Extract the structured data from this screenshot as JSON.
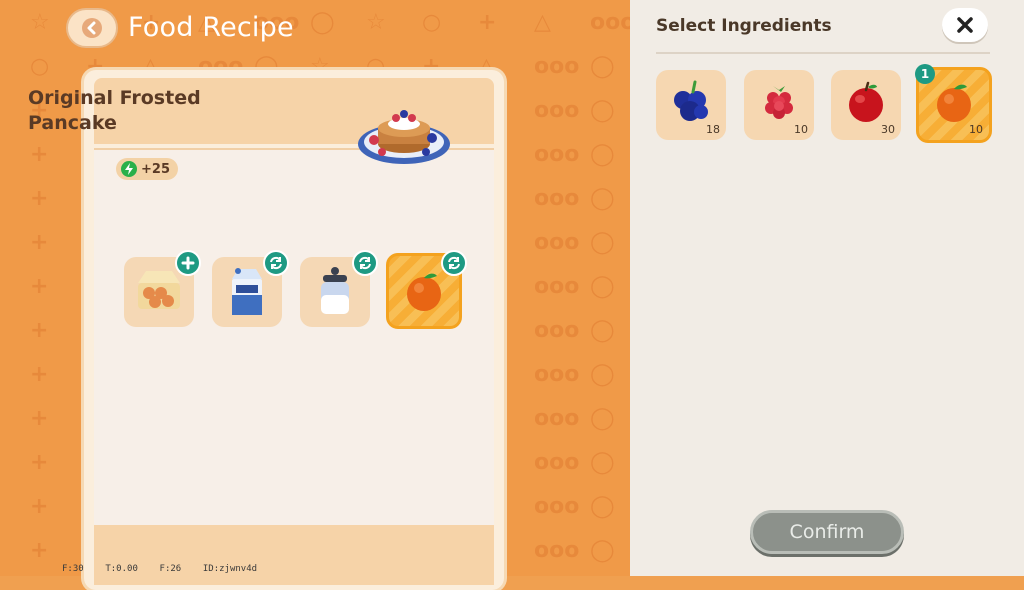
{
  "header": {
    "title": "Food Recipe",
    "back_icon": "chevron-left-icon"
  },
  "recipe": {
    "name_line1": "Original Frosted",
    "name_line2": "Pancake",
    "energy": "+25",
    "dish_icon": "pancake-icon",
    "slots": [
      {
        "icon": "egg-carton-icon",
        "action": "add",
        "selected": false
      },
      {
        "icon": "milk-carton-icon",
        "action": "swap",
        "selected": false
      },
      {
        "icon": "sugar-jar-icon",
        "action": "swap",
        "selected": false
      },
      {
        "icon": "orange-icon",
        "action": "swap",
        "selected": true
      }
    ]
  },
  "ingredient_panel": {
    "title": "Select Ingredients",
    "close_icon": "close-icon",
    "items": [
      {
        "icon": "blueberry-icon",
        "count": "18",
        "selected": false
      },
      {
        "icon": "raspberry-icon",
        "count": "10",
        "selected": false
      },
      {
        "icon": "apple-icon",
        "count": "30",
        "selected": false
      },
      {
        "icon": "orange-icon",
        "count": "10",
        "selected": true,
        "badge": "1"
      }
    ],
    "confirm_label": "Confirm"
  },
  "debug_overlay": {
    "text": "F:30    T:0.00    F:26    ID:zjwnv4d"
  },
  "colors": {
    "background": "#f09a48",
    "accent_green": "#1e9a83",
    "selected_orange": "#f4a21e",
    "panel": "#f1ece5"
  }
}
